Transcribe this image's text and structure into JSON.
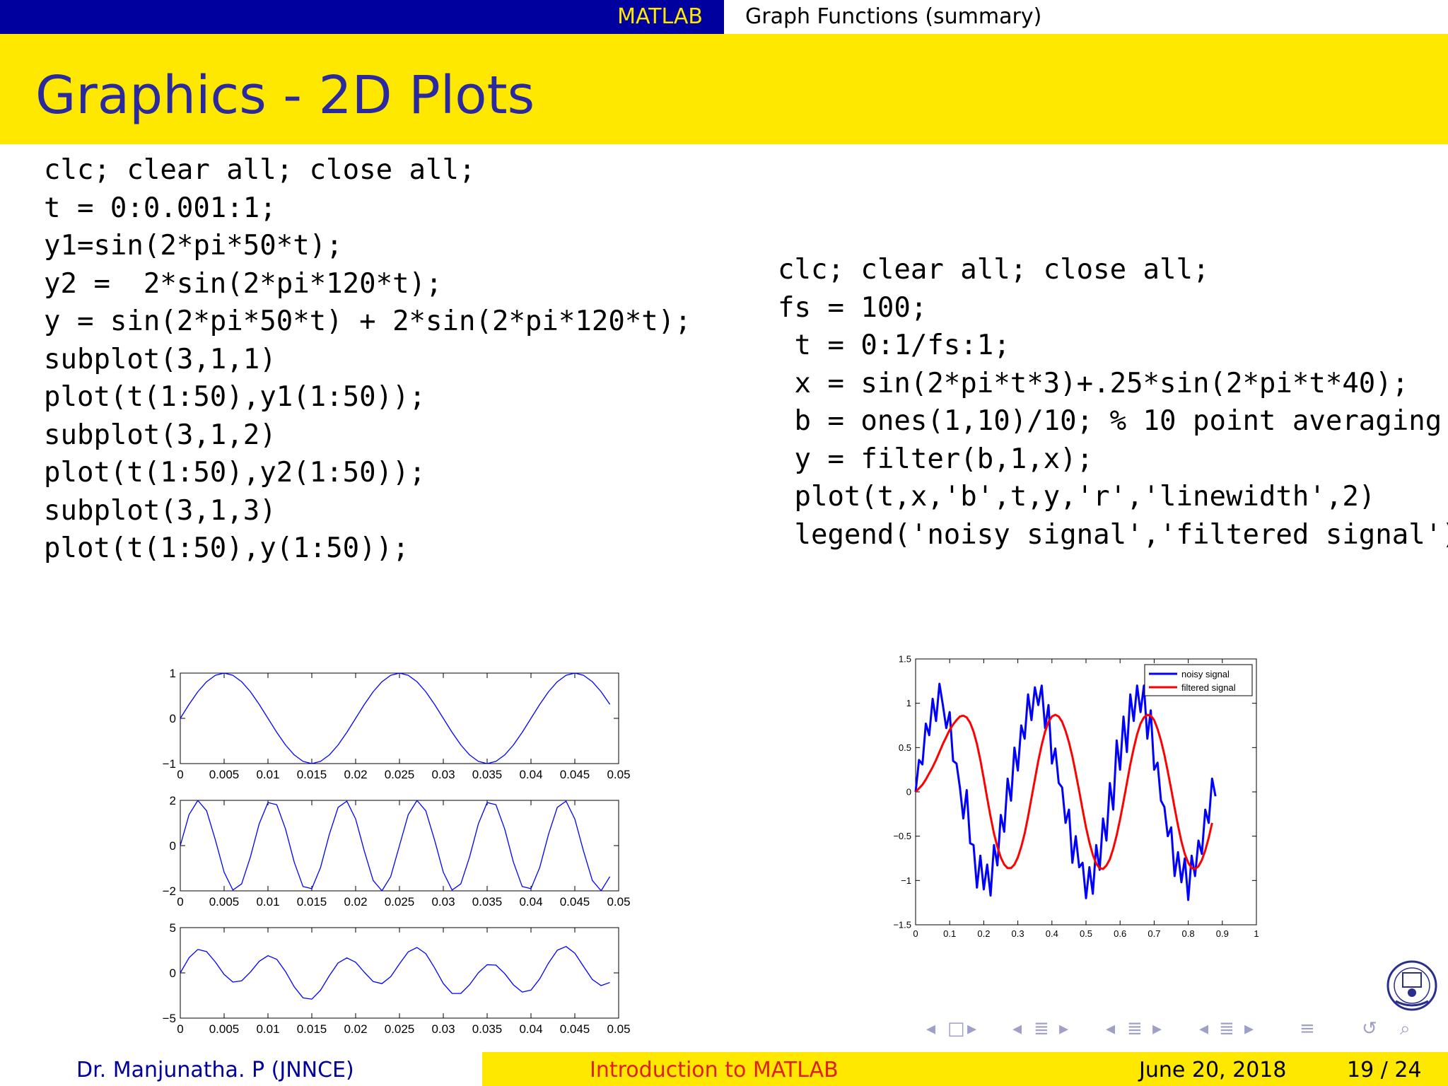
{
  "header": {
    "section": "MATLAB",
    "subsection": "Graph Functions (summary)"
  },
  "slide": {
    "title": "Graphics - 2D Plots"
  },
  "code_left": [
    "clc; clear all; close all;",
    "t = 0:0.001:1;",
    "y1=sin(2*pi*50*t);",
    "y2 =  2*sin(2*pi*120*t);",
    "y = sin(2*pi*50*t) + 2*sin(2*pi*120*t);",
    "subplot(3,1,1)",
    "plot(t(1:50),y1(1:50));",
    "subplot(3,1,2)",
    "plot(t(1:50),y2(1:50));",
    "subplot(3,1,3)",
    "plot(t(1:50),y(1:50));"
  ],
  "code_right": [
    "clc; clear all; close all;",
    "fs = 100;",
    " t = 0:1/fs:1;",
    " x = sin(2*pi*t*3)+.25*sin(2*pi*t*40);",
    " b = ones(1,10)/10; % 10 point averaging",
    " y = filter(b,1,x);",
    " plot(t,x,'b',t,y,'r','linewidth',2)",
    " legend('noisy signal','filtered signal')"
  ],
  "chart_data": [
    {
      "type": "line",
      "x": {
        "start": 0,
        "step": 0.001,
        "count": 50
      },
      "series": [
        {
          "expr": "sin(2*pi*50*t)",
          "color": "#0000ff"
        }
      ],
      "xlim": [
        0,
        0.05
      ],
      "ylim": [
        -1,
        1
      ],
      "xticks": [
        0,
        0.005,
        0.01,
        0.015,
        0.02,
        0.025,
        0.03,
        0.035,
        0.04,
        0.045,
        0.05
      ],
      "xtick_labels": [
        "0",
        "0.005",
        "0.01",
        "0.015",
        "0.02",
        "0.025",
        "0.03",
        "0.035",
        "0.04",
        "0.045",
        "0.05"
      ],
      "yticks": [
        -1,
        0,
        1
      ],
      "ytick_labels": [
        "−1",
        "0",
        "1"
      ]
    },
    {
      "type": "line",
      "x": {
        "start": 0,
        "step": 0.001,
        "count": 50
      },
      "series": [
        {
          "expr": "2*sin(2*pi*120*t)",
          "color": "#0000ff"
        }
      ],
      "xlim": [
        0,
        0.05
      ],
      "ylim": [
        -2,
        2
      ],
      "xticks": [
        0,
        0.005,
        0.01,
        0.015,
        0.02,
        0.025,
        0.03,
        0.035,
        0.04,
        0.045,
        0.05
      ],
      "xtick_labels": [
        "0",
        "0.005",
        "0.01",
        "0.015",
        "0.02",
        "0.025",
        "0.03",
        "0.035",
        "0.04",
        "0.045",
        "0.05"
      ],
      "yticks": [
        -2,
        0,
        2
      ],
      "ytick_labels": [
        "−2",
        "0",
        "2"
      ]
    },
    {
      "type": "line",
      "x": {
        "start": 0,
        "step": 0.001,
        "count": 50
      },
      "series": [
        {
          "expr": "sin(2*pi*50*t) + 2*sin(2*pi*120*t)",
          "color": "#0000ff"
        }
      ],
      "xlim": [
        0,
        0.05
      ],
      "ylim": [
        -5,
        5
      ],
      "xticks": [
        0,
        0.005,
        0.01,
        0.015,
        0.02,
        0.025,
        0.03,
        0.035,
        0.04,
        0.045,
        0.05
      ],
      "xtick_labels": [
        "0",
        "0.005",
        "0.01",
        "0.015",
        "0.02",
        "0.025",
        "0.03",
        "0.035",
        "0.04",
        "0.045",
        "0.05"
      ],
      "yticks": [
        -5,
        0,
        5
      ],
      "ytick_labels": [
        "−5",
        "0",
        "5"
      ]
    },
    {
      "type": "line",
      "x": {
        "start": 0,
        "step": 0.01,
        "count": 101
      },
      "series": [
        {
          "name": "noisy signal",
          "color": "#0000ff",
          "values": [
            0,
            0.36,
            0.31,
            0.77,
            0.64,
            1.05,
            0.8,
            1.22,
            0.98,
            0.72,
            0.9,
            0.35,
            0.32,
            0.05,
            -0.3,
            0.02,
            -0.58,
            -0.6,
            -1.08,
            -0.72,
            -1.1,
            -0.82,
            -1.17,
            -0.6,
            -0.83,
            -0.26,
            -0.45,
            0.15,
            -0.1,
            0.5,
            0.24,
            0.75,
            0.6,
            1.1,
            0.81,
            1.18,
            0.98,
            1.2,
            0.72,
            0.98,
            0.32,
            0.49,
            0.1,
            0.05,
            -0.35,
            -0.2,
            -0.8,
            -0.5,
            -0.85,
            -0.8,
            -1.2,
            -0.85,
            -1.15,
            -0.6,
            -0.88,
            -0.3,
            -0.55,
            0.1,
            -0.2,
            0.58,
            0.25,
            0.85,
            0.45,
            1.1,
            0.8,
            1.2,
            0.9,
            1.2,
            0.6,
            0.92,
            0.25,
            0.33,
            -0.1,
            -0.17,
            -0.5,
            -0.4,
            -0.95,
            -0.68,
            -1.02,
            -0.75,
            -1.22,
            -0.72,
            -0.95,
            -0.55,
            -0.7,
            -0.2,
            -0.35,
            0.15,
            -0.05
          ]
        },
        {
          "name": "filtered signal",
          "color": "#ff0000",
          "values": [
            0,
            0.04,
            0.08,
            0.14,
            0.21,
            0.28,
            0.36,
            0.45,
            0.54,
            0.62,
            0.7,
            0.76,
            0.81,
            0.85,
            0.86,
            0.84,
            0.78,
            0.68,
            0.54,
            0.36,
            0.15,
            -0.07,
            -0.28,
            -0.47,
            -0.62,
            -0.74,
            -0.82,
            -0.86,
            -0.86,
            -0.82,
            -0.74,
            -0.62,
            -0.47,
            -0.28,
            -0.07,
            0.14,
            0.35,
            0.53,
            0.68,
            0.79,
            0.85,
            0.87,
            0.85,
            0.79,
            0.69,
            0.56,
            0.4,
            0.21,
            0.01,
            -0.2,
            -0.4,
            -0.57,
            -0.71,
            -0.81,
            -0.86,
            -0.87,
            -0.83,
            -0.76,
            -0.64,
            -0.49,
            -0.31,
            -0.11,
            0.1,
            0.31,
            0.49,
            0.65,
            0.77,
            0.84,
            0.87,
            0.86,
            0.81,
            0.71,
            0.58,
            0.42,
            0.23,
            0.03,
            -0.18,
            -0.38,
            -0.56,
            -0.7,
            -0.8,
            -0.86,
            -0.87,
            -0.84,
            -0.77,
            -0.66,
            -0.52,
            -0.35
          ]
        }
      ],
      "xlim": [
        0,
        1
      ],
      "ylim": [
        -1.5,
        1.5
      ],
      "xticks": [
        0,
        0.1,
        0.2,
        0.3,
        0.4,
        0.5,
        0.6,
        0.7,
        0.8,
        0.9,
        1
      ],
      "xtick_labels": [
        "0",
        "0.1",
        "0.2",
        "0.3",
        "0.4",
        "0.5",
        "0.6",
        "0.7",
        "0.8",
        "0.9",
        "1"
      ],
      "yticks": [
        -1.5,
        -1,
        -0.5,
        0,
        0.5,
        1,
        1.5
      ],
      "ytick_labels": [
        "−1.5",
        "−1",
        "−0.5",
        "0",
        "0.5",
        "1",
        "1.5"
      ],
      "legend": "top-right",
      "legend_labels": [
        "noisy signal",
        "filtered signal"
      ]
    }
  ],
  "nav_icons": [
    "nav-left-arrow-icon",
    "nav-frame-icon",
    "nav-right-arrow-icon",
    "nav-left-arrow-icon",
    "nav-subsection-icon",
    "nav-right-arrow-icon",
    "nav-left-arrow-icon",
    "nav-section-icon",
    "nav-right-arrow-icon",
    "nav-left-arrow-icon",
    "nav-align-icon",
    "nav-right-arrow-icon",
    "nav-outline-icon",
    "nav-loop-icon",
    "nav-search-icon"
  ],
  "footer": {
    "author": "Dr. Manjunatha. P   (JNNCE)",
    "talk_title": "Introduction to MATLAB",
    "date": "June 20, 2018",
    "page": "19 / 24"
  },
  "colors": {
    "beamer_blue": "#00009e",
    "beamer_yellow": "#ffe800",
    "title_text": "#2a2a9e",
    "footer_red": "#e0201a",
    "nav_icon": "#9fa0c8"
  }
}
